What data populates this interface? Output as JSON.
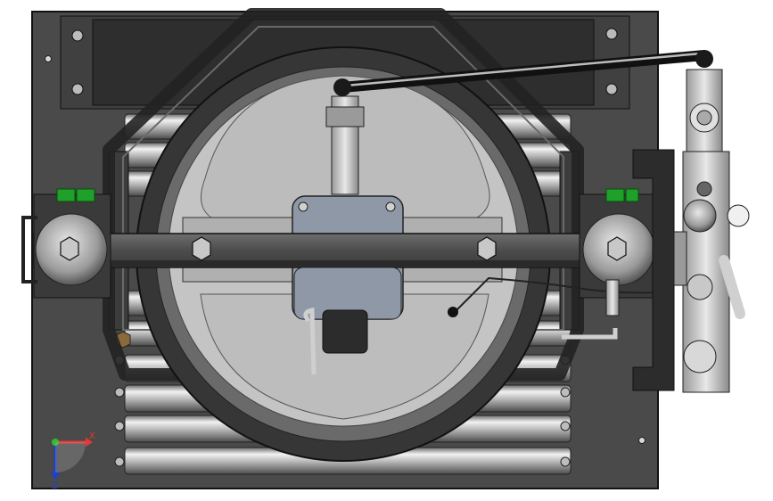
{
  "viewport": {
    "background": "#ffffff",
    "view_orientation": "top view"
  },
  "triad": {
    "x_label": "X",
    "z_label": "Z",
    "x_color": "#e53935",
    "y_color": "#2fbf2f",
    "z_color": "#1e3fd6"
  },
  "colors": {
    "plate": "#4a4a4a",
    "plate_edge": "#1a1a1a",
    "roller_light": "#e6e6e6",
    "roller_dark": "#5a5a5a",
    "wheel_tire": "#3a3a3a",
    "wheel_face": "#c4c4c4",
    "hub_light": "#d8d8d8",
    "bar": "#555555",
    "bracket_green": "#1fa02a",
    "valve_body": "#d0d0d0"
  }
}
